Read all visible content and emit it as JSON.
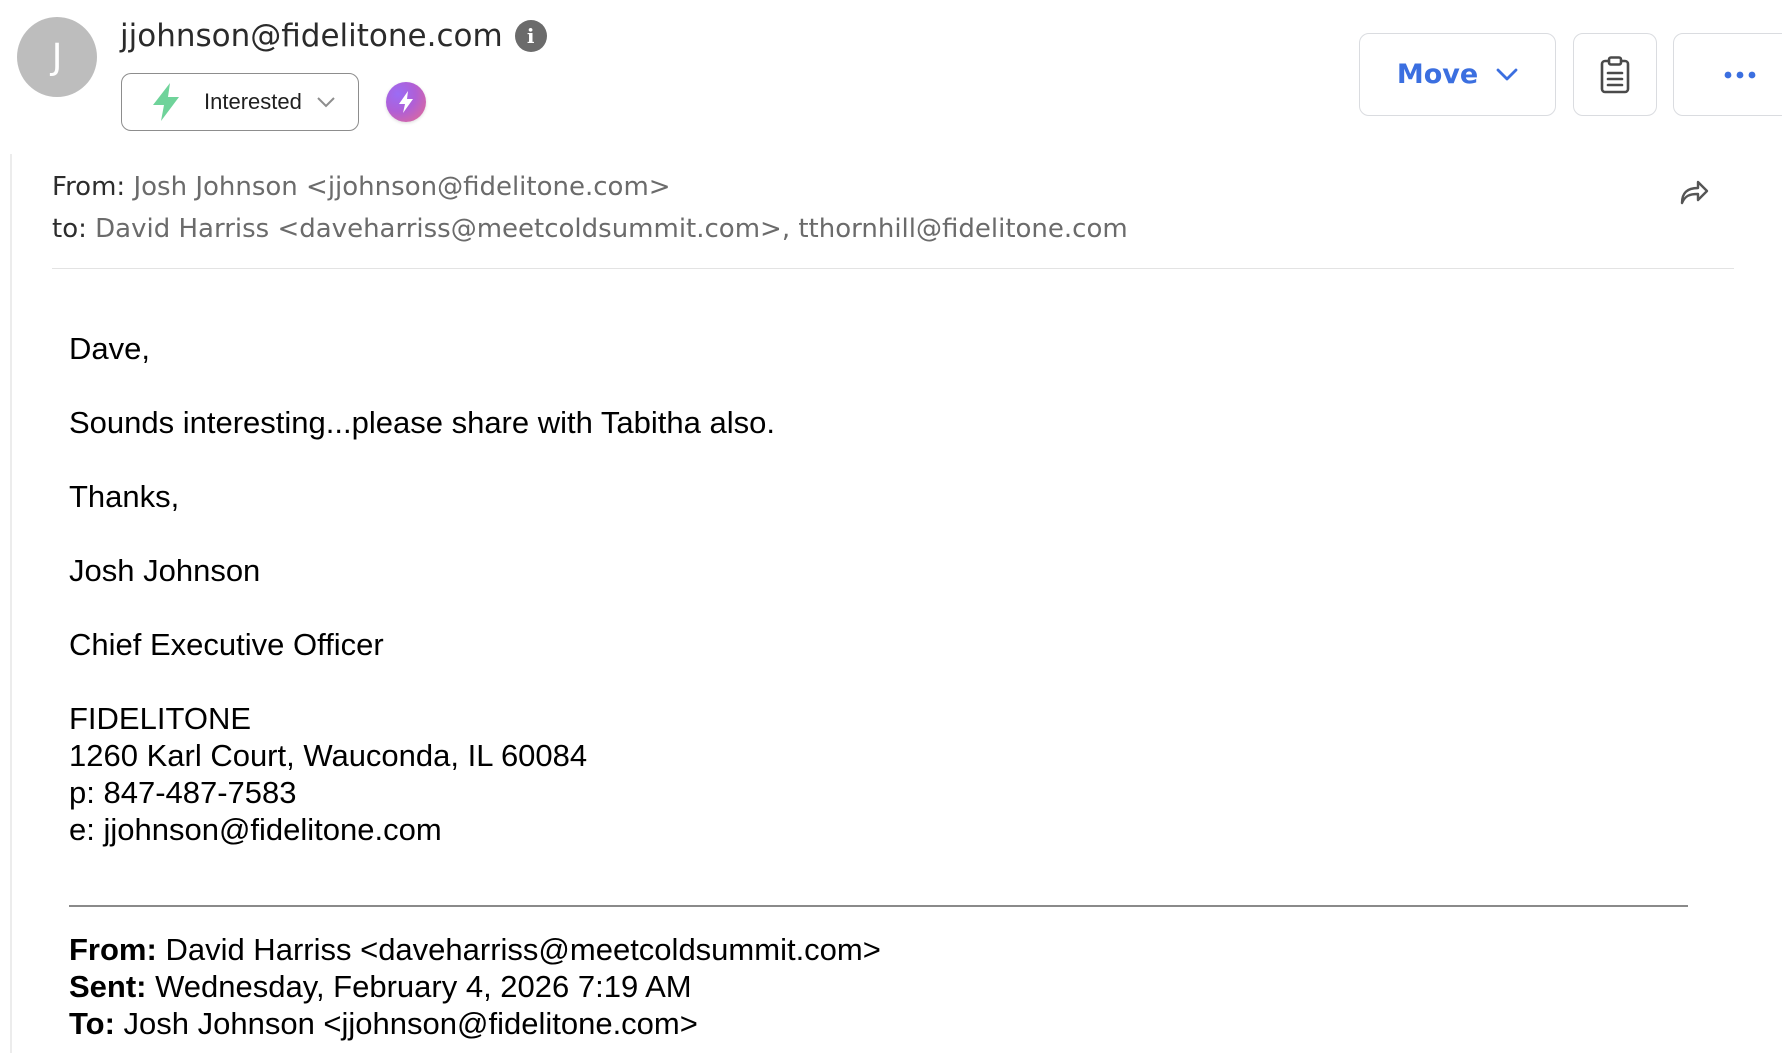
{
  "header": {
    "avatar_initial": "J",
    "sender_email": "jjohnson@fidelitone.com",
    "info_icon": "info-icon",
    "status_label": "Interested",
    "status_icon": "lightning-bolt-icon",
    "status_color": "#6fd39a",
    "ai_icon": "ai-lightning-icon",
    "move_label": "Move",
    "accent_color": "#3b6fe0"
  },
  "message": {
    "from_label": "From:",
    "from_value": "Josh Johnson <jjohnson@fidelitone.com>",
    "to_label": "to:",
    "to_value": "David Harriss <daveharriss@meetcoldsummit.com>, tthornhill@fidelitone.com",
    "body": {
      "greeting": "Dave,",
      "line1": "Sounds interesting...please share with Tabitha also.",
      "closing": "Thanks,",
      "signature_name": "Josh Johnson",
      "signature_title": "Chief Executive Officer",
      "company": "FIDELITONE",
      "address": "1260 Karl Court, Wauconda, IL 60084",
      "phone": "p: 847-487-7583",
      "email": "e: jjohnson@fidelitone.com"
    },
    "quoted": {
      "from_label": "From:",
      "from_value": " David Harriss <daveharriss@meetcoldsummit.com>",
      "sent_label": "Sent:",
      "sent_value": " Wednesday, February 4, 2026 7:19 AM",
      "to_label": "To:",
      "to_value": " Josh Johnson <jjohnson@fidelitone.com>"
    }
  }
}
